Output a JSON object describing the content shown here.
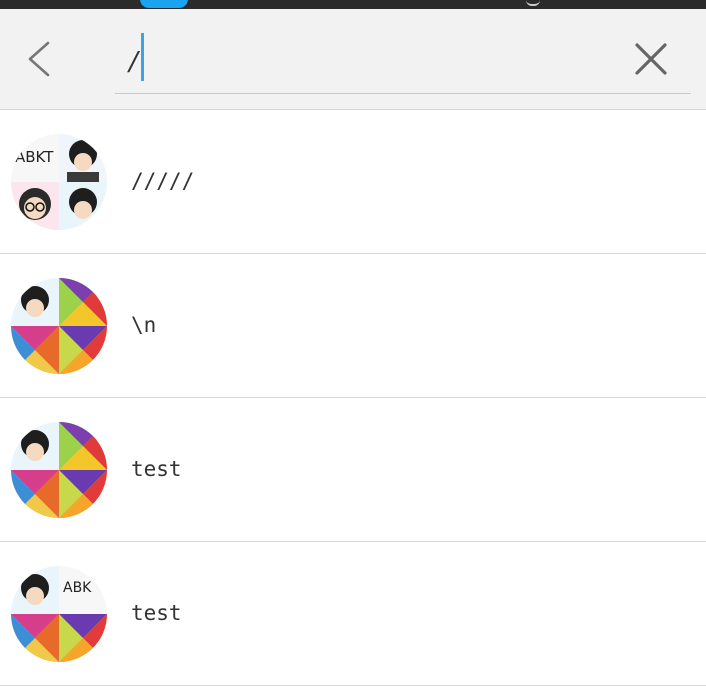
{
  "search": {
    "value": "/",
    "back_icon": "chevron-left-icon",
    "clear_icon": "close-icon"
  },
  "results": [
    {
      "label": "/////",
      "avatar": "avatar-collage"
    },
    {
      "label": "\\n",
      "avatar": "avatar-collage"
    },
    {
      "label": "test",
      "avatar": "avatar-collage"
    },
    {
      "label": "test",
      "avatar": "avatar-collage"
    }
  ],
  "colors": {
    "accent": "#3aa3e6",
    "header_bg": "#f2f2f2",
    "divider": "#d9d9d9",
    "text": "#333333"
  }
}
